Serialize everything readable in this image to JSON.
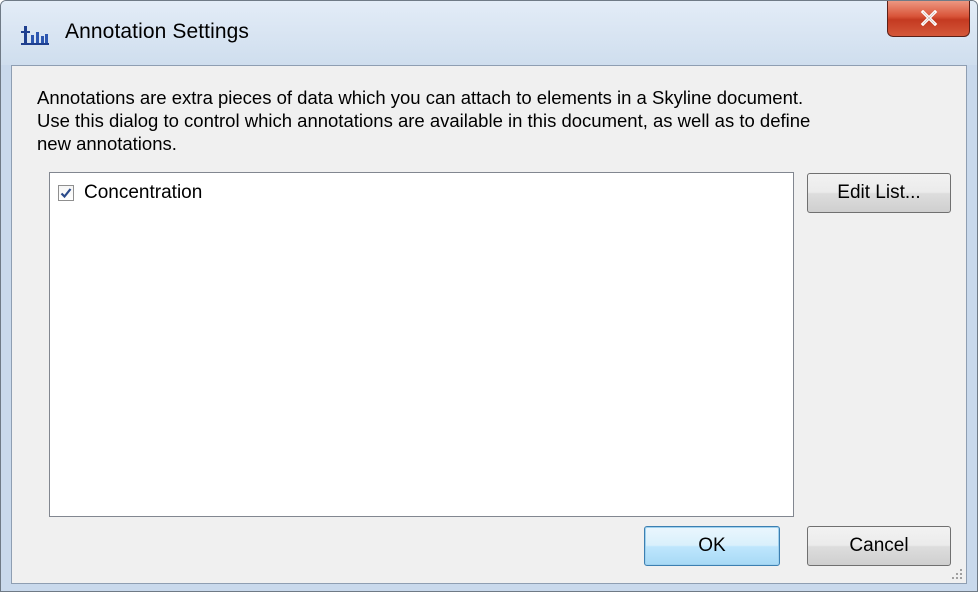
{
  "window": {
    "title": "Annotation Settings"
  },
  "description": "Annotations are extra pieces of data which you can attach to elements in a Skyline document.\nUse this dialog to control which annotations are available in this document, as well as to define\nnew annotations.",
  "annotations_list": {
    "items": [
      {
        "label": "Concentration",
        "checked": true
      }
    ]
  },
  "buttons": {
    "edit_list": "Edit List...",
    "ok": "OK",
    "cancel": "Cancel"
  },
  "icons": {
    "app": "skyline-app-icon",
    "close": "close-icon",
    "check": "checkmark-icon",
    "grip": "resize-grip-icon"
  },
  "colors": {
    "close_button": "#c43a21",
    "ok_button_border": "#3c7fb1",
    "checkmark": "#2a4a8a"
  }
}
